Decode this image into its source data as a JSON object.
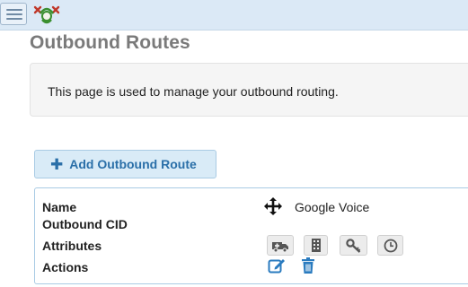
{
  "header": {
    "menu_icon": "hamburger-menu-icon",
    "logo_icon": "freepbx-logo-icon"
  },
  "page": {
    "title": "Outbound Routes",
    "info_text": "This page is used to manage your outbound routing."
  },
  "toolbar": {
    "add_icon": "plus-icon",
    "add_label": "Add Outbound Route"
  },
  "route": {
    "labels": {
      "name": "Name",
      "outbound_cid": "Outbound CID",
      "attributes": "Attributes",
      "actions": "Actions"
    },
    "name_value": "Google Voice",
    "outbound_cid_value": "",
    "move_icon": "move-arrows-icon",
    "attribute_icons": [
      "emergency-ambulance-icon",
      "intra-company-building-icon",
      "password-key-icon",
      "time-group-clock-icon"
    ],
    "action_icons": [
      "edit-icon",
      "delete-trash-icon"
    ]
  },
  "colors": {
    "header_bg": "#dbe9f6",
    "accent": "#2a7bbf",
    "title": "#7a7a7a",
    "button_bg": "#d9ebf7"
  }
}
